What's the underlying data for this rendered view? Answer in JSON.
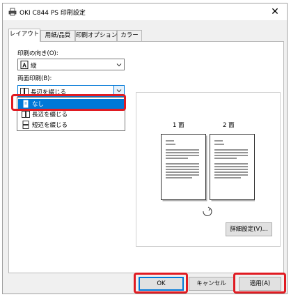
{
  "window": {
    "title": "OKI C844 PS 印刷設定",
    "close_symbol": "✕"
  },
  "tabs": [
    {
      "label": "レイアウト",
      "active": true
    },
    {
      "label": "用紙/品質",
      "active": false
    },
    {
      "label": "印刷オプション",
      "active": false
    },
    {
      "label": "カラー",
      "active": false
    }
  ],
  "orientation": {
    "label": "印刷の向き(O):",
    "value": "縦",
    "icon": "portrait-icon"
  },
  "duplex": {
    "label": "両面印刷(B):",
    "value": "長辺を綴じる",
    "icon": "long-edge-icon",
    "options": [
      {
        "label": "なし",
        "icon": "single-side-icon",
        "selected": true
      },
      {
        "label": "長辺を綴じる",
        "icon": "long-edge-icon",
        "selected": false
      },
      {
        "label": "短辺を綴じる",
        "icon": "short-edge-icon",
        "selected": false
      }
    ]
  },
  "preview": {
    "page1_label": "1 面",
    "page2_label": "2 面"
  },
  "buttons": {
    "advanced": "詳細設定(V)...",
    "ok": "OK",
    "cancel": "キャンセル",
    "apply": "適用(A)"
  },
  "colors": {
    "accent": "#0078d7",
    "highlight": "#e01b22",
    "selection_bg": "#0078d7"
  }
}
